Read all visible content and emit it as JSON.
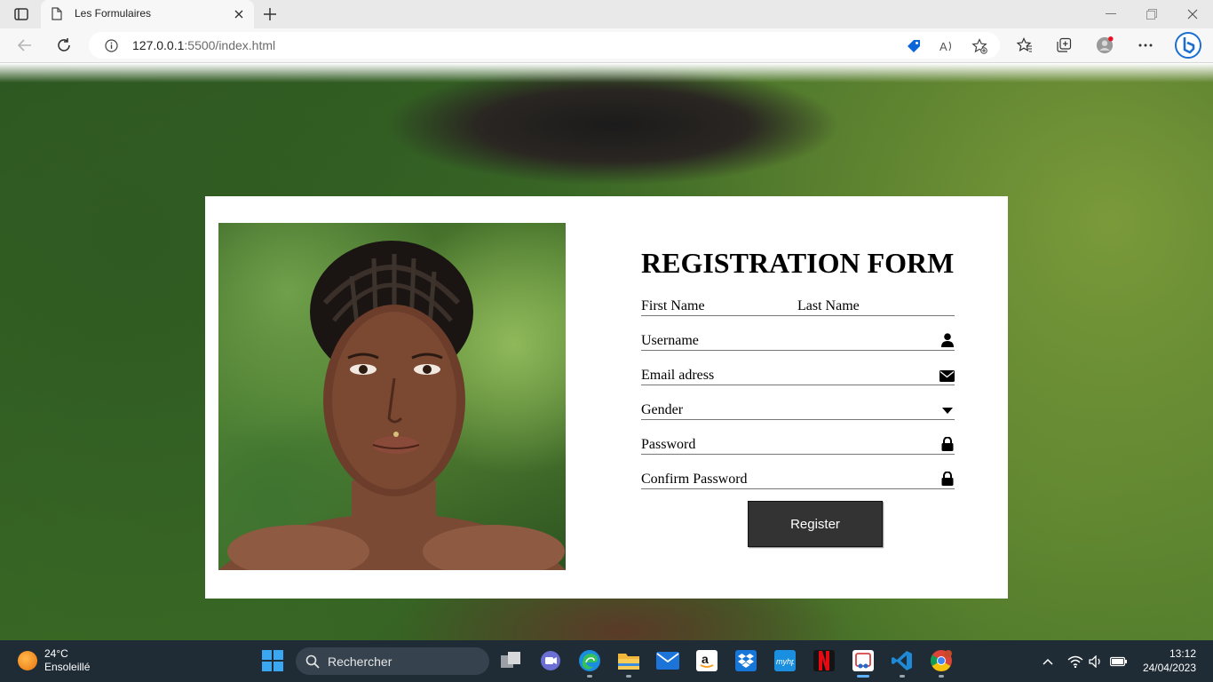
{
  "browser": {
    "tab_title": "Les Formulaires",
    "url_host": "127.0.0.1",
    "url_rest": ":5500/index.html"
  },
  "form": {
    "title": "REGISTRATION FORM",
    "first_name_label": "First Name",
    "last_name_label": "Last Name",
    "username_label": "Username",
    "email_label": "Email adress",
    "gender_label": "Gender",
    "password_label": "Password",
    "confirm_password_label": "Confirm Password",
    "register_label": "Register"
  },
  "taskbar": {
    "temperature": "24°C",
    "weather": "Ensoleillé",
    "search_placeholder": "Rechercher",
    "time": "13:12",
    "date": "24/04/2023"
  },
  "icons": {
    "username": "user-icon",
    "email": "envelope-icon",
    "gender": "caret-down-icon",
    "password": "lock-icon",
    "confirm_password": "lock-icon"
  },
  "colors": {
    "register_button": "#333333",
    "taskbar": "#1f2b35"
  }
}
